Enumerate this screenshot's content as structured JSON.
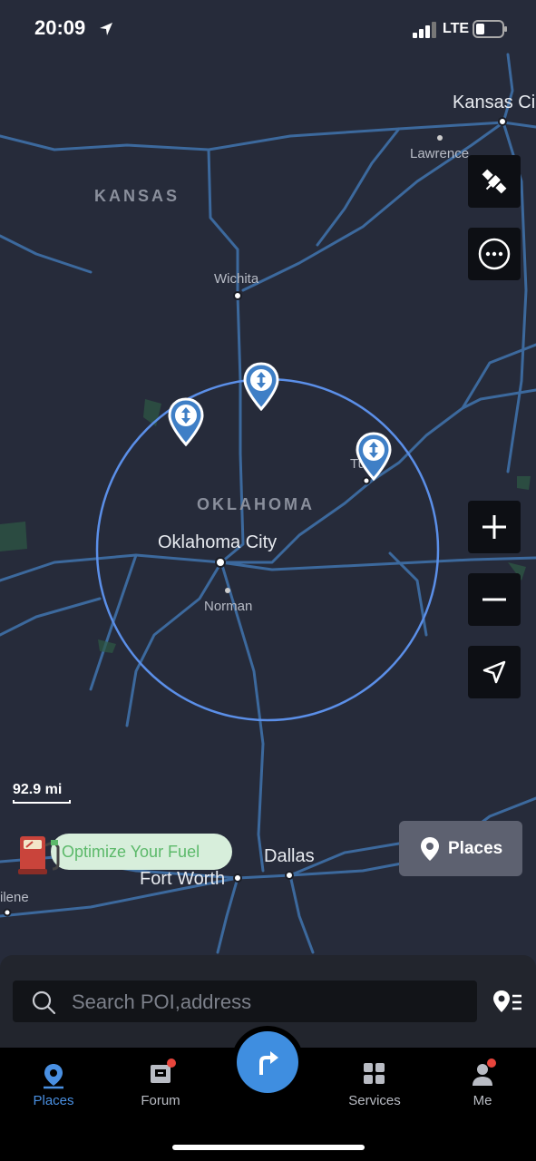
{
  "status_bar": {
    "time": "20:09",
    "network": "LTE"
  },
  "map": {
    "regions": {
      "kansas": "KANSAS",
      "oklahoma": "OKLAHOMA"
    },
    "cities": {
      "kansas_city": "Kansas Ci",
      "lawrence": "Lawrence",
      "wichita": "Wichita",
      "tulsa": "Tu",
      "oklahoma_city": "Oklahoma City",
      "norman": "Norman",
      "dallas": "Dallas",
      "fort_worth": "Fort Worth",
      "abilene": "ilene"
    },
    "scale": "92.9 mi",
    "colors": {
      "road": "#3f70a8",
      "radius_circle": "#5b8fe8",
      "pin": "#3f7fc6",
      "background": "#262b3a"
    }
  },
  "controls": {
    "satellite": "satellite-icon",
    "more": "more-icon",
    "zoom_in": "plus-icon",
    "zoom_out": "minus-icon",
    "locate": "navigation-arrow-icon"
  },
  "fuel_banner": {
    "label": "Optimize Your Fuel"
  },
  "places_button": {
    "label": "Places"
  },
  "search": {
    "placeholder": "Search POI,address"
  },
  "tabs": [
    {
      "label": "Places",
      "active": true
    },
    {
      "label": "Forum",
      "badge": true
    },
    {
      "label": "Services"
    },
    {
      "label": "Me",
      "badge": true
    }
  ],
  "accent_color": "#4a90e2"
}
